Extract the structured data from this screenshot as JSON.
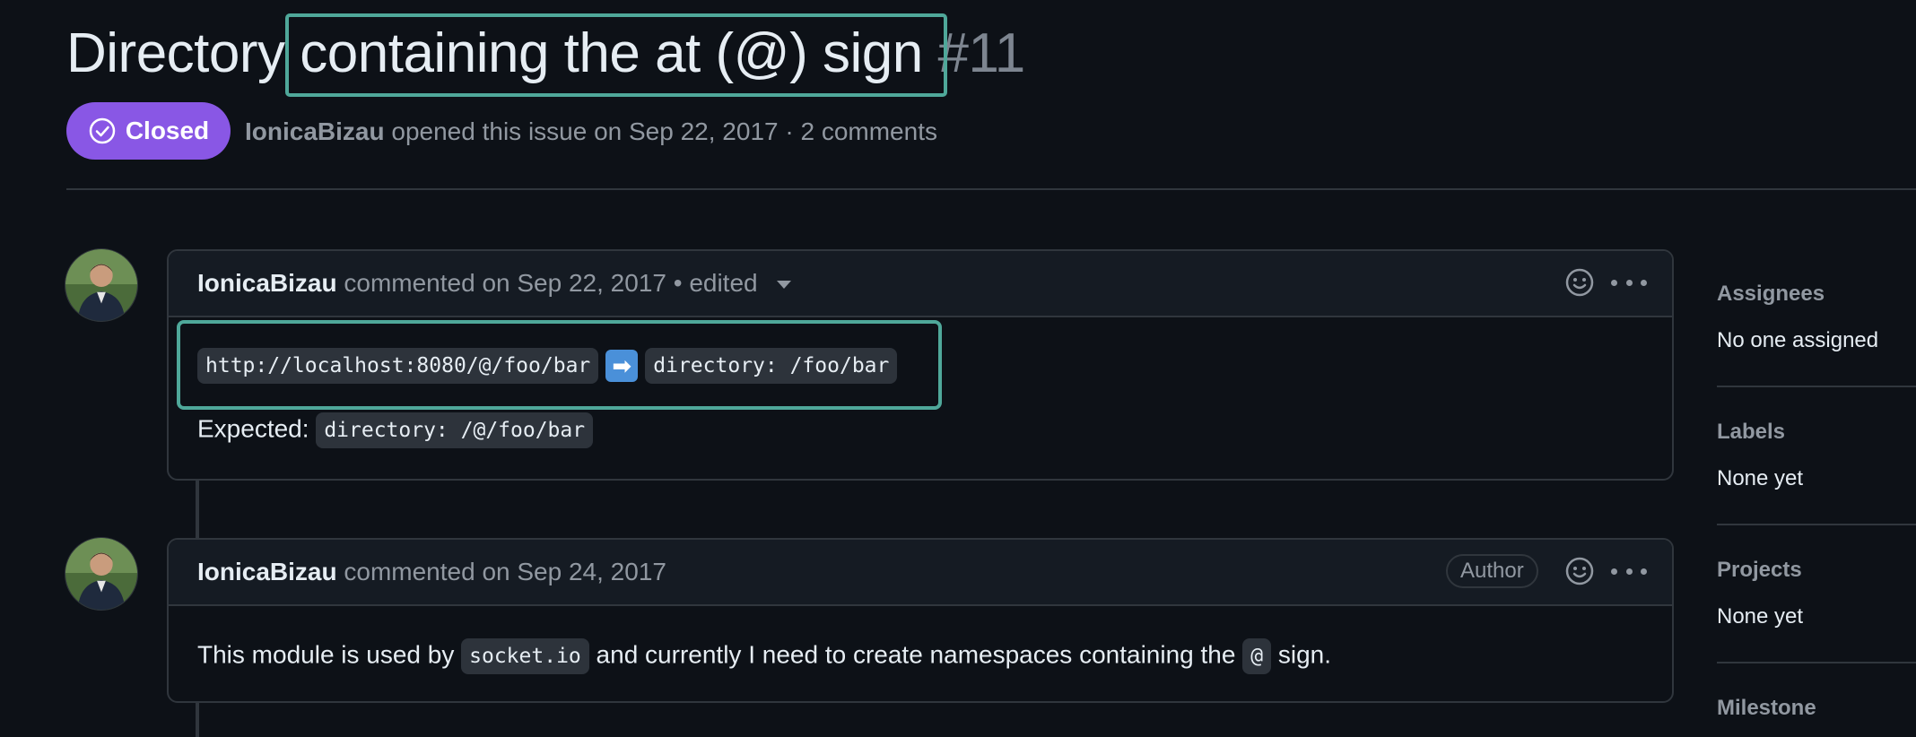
{
  "issue": {
    "title_prefix": "Directory",
    "title_highlight": "containing the at (@) sign",
    "number": "#11",
    "status": "Closed",
    "author": "IonicaBizau",
    "opened_text": "opened this issue on Sep 22, 2017 · 2 comments"
  },
  "comments": [
    {
      "author": "IonicaBizau",
      "meta": "commented on Sep 22, 2017 • edited",
      "code_url": "http://localhost:8080/@/foo/bar",
      "arrow": "➡",
      "code_dir": "directory: /foo/bar",
      "expected_label": "Expected:",
      "expected_code": "directory: /@/foo/bar"
    },
    {
      "author": "IonicaBizau",
      "meta": "commented on Sep 24, 2017",
      "tag": "Author",
      "text_before": "This module is used by",
      "code1": "socket.io",
      "text_middle": "and currently I need to create namespaces containing the",
      "code2": "@",
      "text_after": "sign."
    }
  ],
  "sidebar": {
    "assignees_label": "Assignees",
    "assignees_value": "No one assigned",
    "labels_label": "Labels",
    "labels_value": "None yet",
    "projects_label": "Projects",
    "projects_value": "None yet",
    "milestone_label": "Milestone"
  },
  "colors": {
    "background": "#0d1117",
    "closed_badge": "#8957e5",
    "highlight": "#4fa89a"
  }
}
